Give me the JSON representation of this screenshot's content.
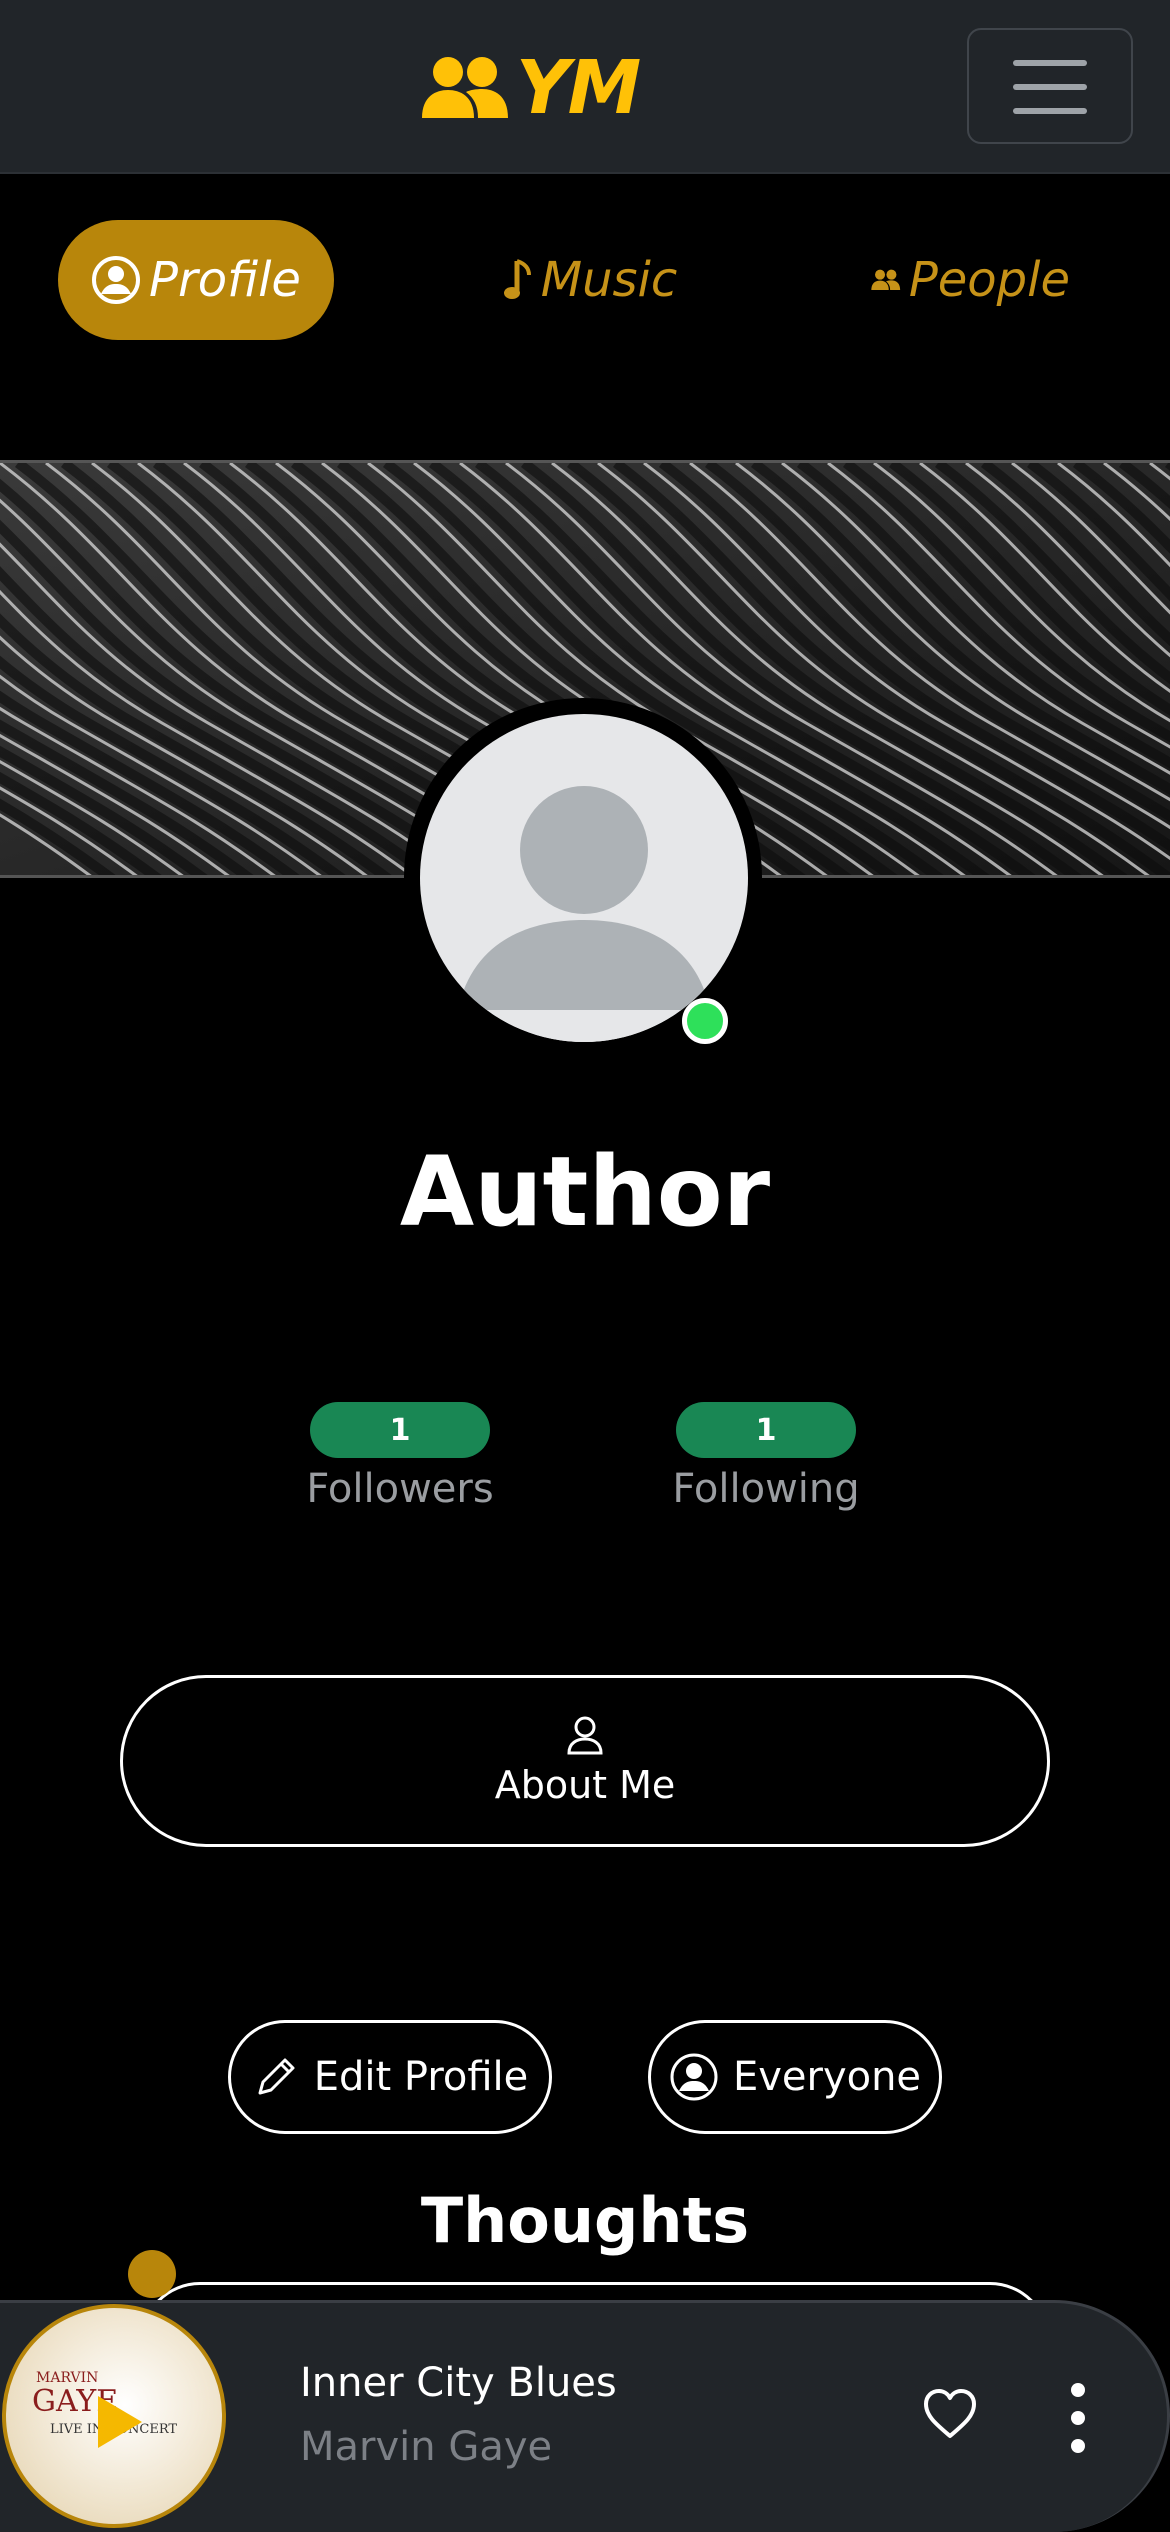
{
  "header": {
    "brand_text": "YM",
    "brand_icon": "users-icon",
    "menu_icon": "hamburger-menu-icon",
    "accent_color": "#ffc107"
  },
  "tabs": [
    {
      "label": "Profile",
      "icon": "user-circle-icon",
      "active": true
    },
    {
      "label": "Music",
      "icon": "music-note-icon",
      "active": false
    },
    {
      "label": "People",
      "icon": "users-icon",
      "active": false
    }
  ],
  "profile": {
    "name": "Author",
    "online": true,
    "stats": [
      {
        "count": "1",
        "label": "Followers"
      },
      {
        "count": "1",
        "label": "Following"
      }
    ]
  },
  "actions": {
    "about_label": "About Me",
    "edit_label": "Edit Profile",
    "visibility_label": "Everyone"
  },
  "thoughts": {
    "title": "Thoughts"
  },
  "player": {
    "song": "Inner City Blues",
    "artist": "Marvin Gaye",
    "album_art_text": [
      "MARVIN",
      "GAYE",
      "LIVE IN CONCERT"
    ]
  },
  "colors": {
    "gold": "#b8860b",
    "green": "#198754",
    "online": "#2ee05a",
    "navbar": "#212529"
  }
}
